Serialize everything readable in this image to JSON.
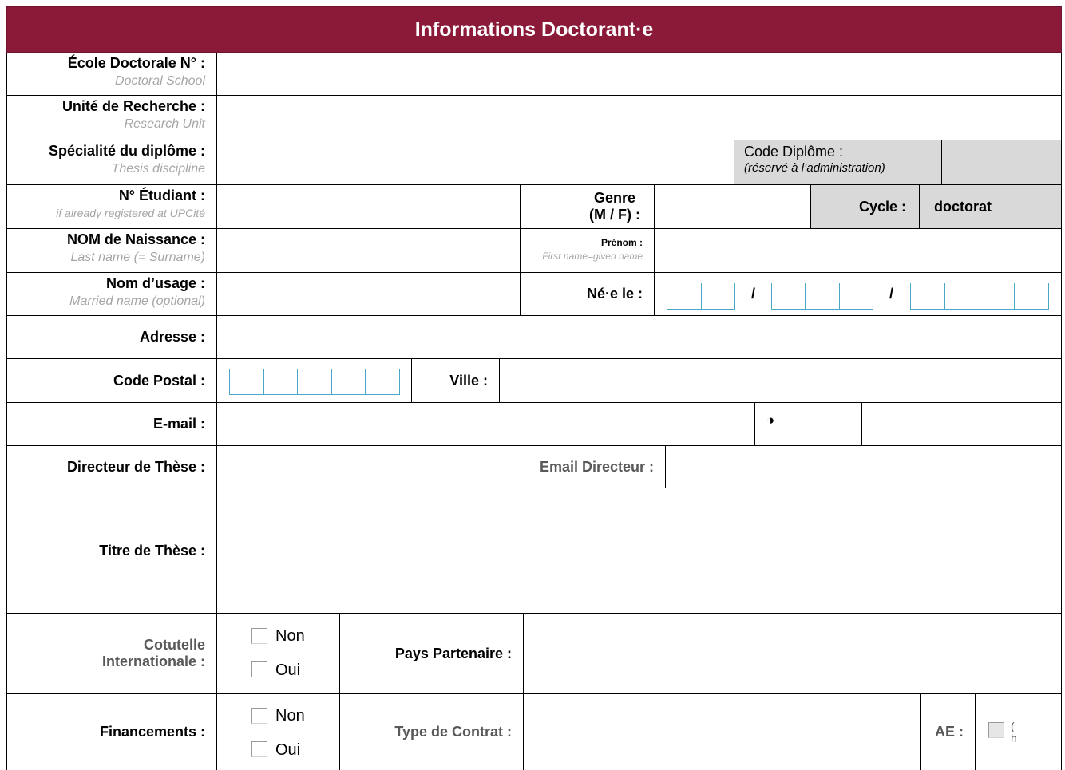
{
  "header": {
    "title": "Informations Doctorant·e"
  },
  "fields": {
    "ecole": {
      "label": "École Doctorale N° :",
      "sub": "Doctoral School"
    },
    "unite": {
      "label": "Unité de Recherche :",
      "sub": "Research Unit"
    },
    "specialite": {
      "label": "Spécialité du diplôme :",
      "sub": "Thesis discipline"
    },
    "code_diplome": {
      "label": "Code Diplôme :",
      "sub": "(réservé à l’administration)"
    },
    "etudiant": {
      "label": "N° Étudiant :",
      "sub": "if already registered at UPCité"
    },
    "genre": {
      "label_line1": "Genre",
      "label_line2": "(M / F) :"
    },
    "cycle": {
      "label": "Cycle :",
      "value": "doctorat"
    },
    "nom_naissance": {
      "label": "NOM de Naissance :",
      "sub": "Last name (= Surname)"
    },
    "prenom": {
      "label": "Prénom :",
      "sub": "First name=given name"
    },
    "nom_usage": {
      "label": "Nom d’usage :",
      "sub": "Married name (optional)"
    },
    "ne_le": {
      "label": "Né·e le :",
      "sep1": "/",
      "sep2": "/"
    },
    "adresse": {
      "label": "Adresse :"
    },
    "code_postal": {
      "label": "Code Postal :"
    },
    "ville": {
      "label": "Ville :"
    },
    "email": {
      "label": "E-mail :",
      "phone_icon": "◑"
    },
    "directeur": {
      "label": "Directeur de Thèse :"
    },
    "email_directeur": {
      "label": "Email Directeur :"
    },
    "titre": {
      "label": "Titre de Thèse :"
    },
    "cotutelle": {
      "label_line1": "Cotutelle",
      "label_line2": "Internationale :",
      "opt_non": "Non",
      "opt_oui": "Oui"
    },
    "pays": {
      "label": "Pays Partenaire :"
    },
    "financements": {
      "label": "Financements :",
      "opt_non": "Non",
      "opt_oui": "Oui"
    },
    "contrat": {
      "label": "Type de Contrat :"
    },
    "ae": {
      "label": "AE :",
      "clipped": "( h"
    }
  },
  "colors": {
    "header_bg": "#8b1a39",
    "grey_cell": "#d9d9d9",
    "box_border": "#4aa7c8",
    "grey_text": "#595959"
  }
}
